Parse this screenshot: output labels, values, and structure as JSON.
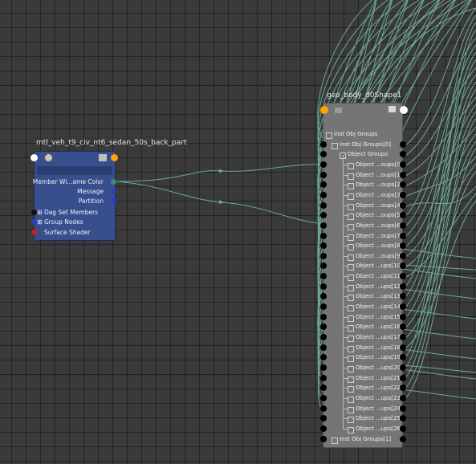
{
  "shader_node": {
    "title": "mtl_veh_t9_civ_nt6_sedan_50s_back_part",
    "rows": [
      {
        "label": "Member Wi...ame Color",
        "port": "right-green"
      },
      {
        "label": "Message",
        "port": "right-blue"
      },
      {
        "label": "Partition",
        "port": "right-blue"
      },
      {
        "label": "Dag Set Members",
        "port": "left-black",
        "expand": "⊞"
      },
      {
        "label": "Group Nodes",
        "port": "left-blue",
        "expand": "⊞"
      },
      {
        "label": "Surface Shader",
        "port": "left-red"
      }
    ],
    "icons": [
      "shading-group-icon",
      "list-icon",
      "input-port-icon",
      "output-port-icon"
    ]
  },
  "mesh_node": {
    "title": "geo_body_d0Shape1",
    "rows": [
      {
        "label": "Inst Obj Groups",
        "expand": "⊟"
      },
      {
        "label": "Inst Obj Groups[0]",
        "expand": "⊟"
      },
      {
        "label": "Object Groups",
        "expand": "⊟"
      },
      {
        "label": "Object ...oups[0]",
        "expand": "⊞"
      },
      {
        "label": "Object ...oups[1]",
        "expand": "⊞"
      },
      {
        "label": "Object ...oups[2]",
        "expand": "⊞"
      },
      {
        "label": "Object ...oups[3]",
        "expand": "⊞"
      },
      {
        "label": "Object ...oups[4]",
        "expand": "⊞"
      },
      {
        "label": "Object ...oups[5]",
        "expand": "⊞"
      },
      {
        "label": "Object ...oups[6]",
        "expand": "⊞"
      },
      {
        "label": "Object ...oups[7]",
        "expand": "⊞"
      },
      {
        "label": "Object ...oups[8]",
        "expand": "⊞"
      },
      {
        "label": "Object ...oups[9]",
        "expand": "⊞"
      },
      {
        "label": "Object ...ups[10]",
        "expand": "⊞"
      },
      {
        "label": "Object ...ups[11]",
        "expand": "⊞"
      },
      {
        "label": "Object ...ups[12]",
        "expand": "⊞"
      },
      {
        "label": "Object ...ups[13]",
        "expand": "⊞"
      },
      {
        "label": "Object ...ups[14]",
        "expand": "⊞"
      },
      {
        "label": "Object ...ups[15]",
        "expand": "⊞"
      },
      {
        "label": "Object ...ups[16]",
        "expand": "⊞"
      },
      {
        "label": "Object ...ups[17]",
        "expand": "⊞"
      },
      {
        "label": "Object ...ups[18]",
        "expand": "⊞"
      },
      {
        "label": "Object ...ups[19]",
        "expand": "⊞"
      },
      {
        "label": "Object ...ups[20]",
        "expand": "⊞"
      },
      {
        "label": "Object ...ups[21]",
        "expand": "⊞"
      },
      {
        "label": "Object ...ups[22]",
        "expand": "⊞"
      },
      {
        "label": "Object ...ups[23]",
        "expand": "⊞"
      },
      {
        "label": "Object ...ups[24]",
        "expand": "⊞"
      },
      {
        "label": "Object ...ups[25]",
        "expand": "⊞"
      },
      {
        "label": "Object ...ups[26]",
        "expand": "⊞"
      },
      {
        "label": "Inst Obj Groups[1]",
        "expand": "⊞"
      }
    ],
    "icons": [
      "mesh-icon",
      "list-icon",
      "input-port-icon",
      "output-port-icon"
    ]
  },
  "colors": {
    "background": "#3a3a3a",
    "shader_node": "#374f8c",
    "mesh_node": "#757575",
    "wire": "#6fa89a",
    "port_input": "#ffa500",
    "port_output": "#ffffff"
  }
}
